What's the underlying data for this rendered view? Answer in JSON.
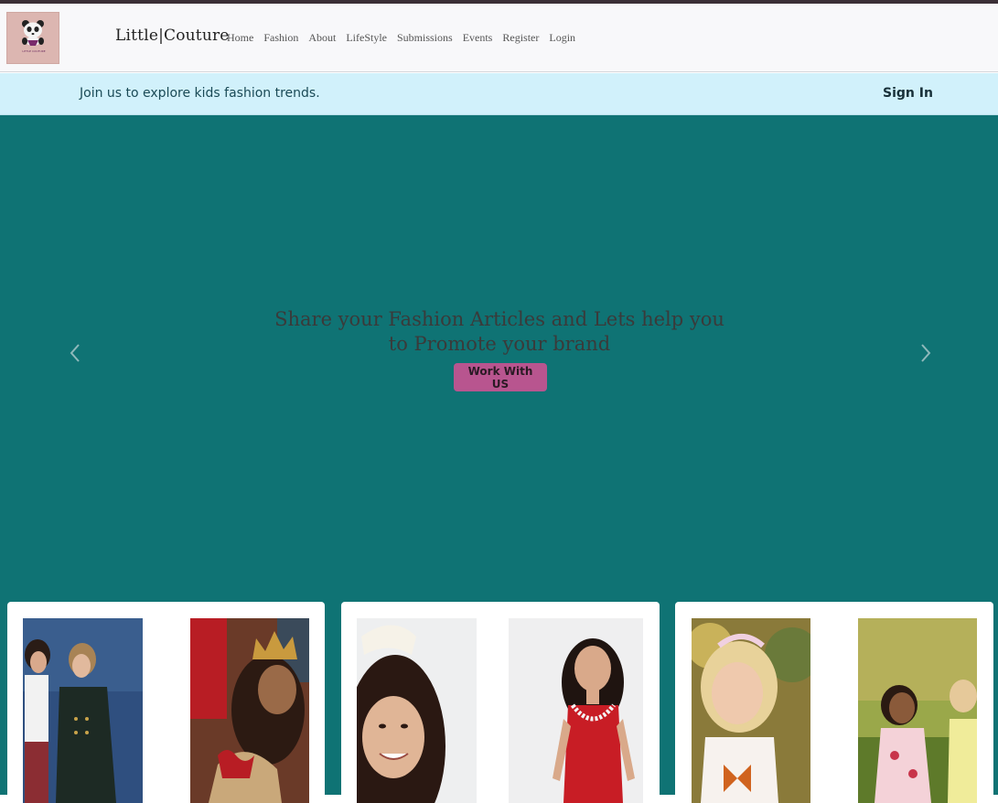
{
  "brand": {
    "name": "Little|Couture",
    "logo_text": "LITTLE COUTURE"
  },
  "nav": {
    "items": [
      {
        "label": "Home"
      },
      {
        "label": "Fashion"
      },
      {
        "label": "About"
      },
      {
        "label": "LifeStyle"
      },
      {
        "label": "Submissions"
      },
      {
        "label": "Events"
      },
      {
        "label": "Register"
      },
      {
        "label": "Login"
      }
    ]
  },
  "infobar": {
    "message": "Join us to explore kids fashion trends.",
    "sign_in": "Sign In"
  },
  "hero": {
    "line1": "Share your Fashion Articles and Lets help you",
    "line2": "to Promote your brand",
    "button": "Work With US"
  },
  "icons": {
    "prev": "chevron-left-icon",
    "next": "chevron-right-icon",
    "logo": "panda-icon"
  },
  "colors": {
    "hero_bg": "#0f7374",
    "button_bg": "#b8558f",
    "infobar_bg": "#d1f1fb",
    "topstrip": "#3b2f36"
  }
}
